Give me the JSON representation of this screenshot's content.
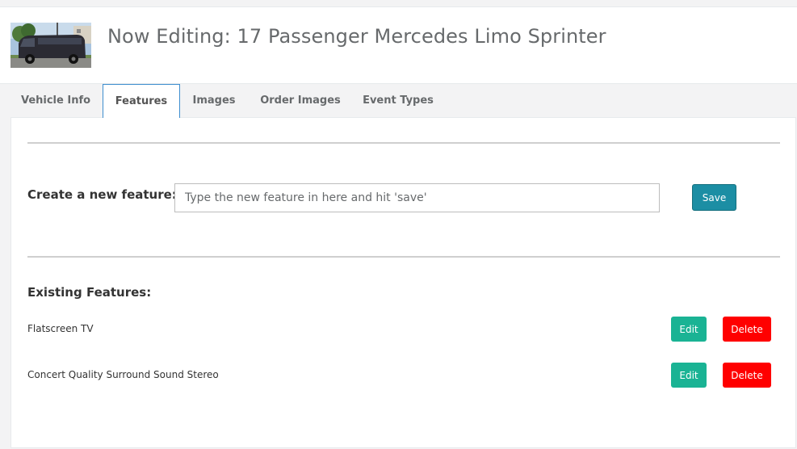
{
  "header": {
    "title": "Now Editing: 17 Passenger Mercedes Limo Sprinter",
    "thumbnail_icon": "vehicle-photo"
  },
  "tabs": [
    {
      "label": "Vehicle Info",
      "active": false
    },
    {
      "label": "Features",
      "active": true
    },
    {
      "label": "Images",
      "active": false
    },
    {
      "label": "Order Images",
      "active": false
    },
    {
      "label": "Event Types",
      "active": false
    }
  ],
  "create": {
    "label": "Create a new feature:",
    "placeholder": "Type the new feature in here and hit 'save'",
    "value": "",
    "save_label": "Save"
  },
  "existing": {
    "label": "Existing Features:",
    "features": [
      {
        "name": "Flatscreen TV",
        "edit_label": "Edit",
        "delete_label": "Delete"
      },
      {
        "name": "Concert Quality Surround Sound Stereo",
        "edit_label": "Edit",
        "delete_label": "Delete"
      }
    ]
  },
  "colors": {
    "save": "#1c8ea4",
    "edit": "#1ab394",
    "delete": "#ff0000",
    "active_tab_border": "#3e8ecf"
  }
}
